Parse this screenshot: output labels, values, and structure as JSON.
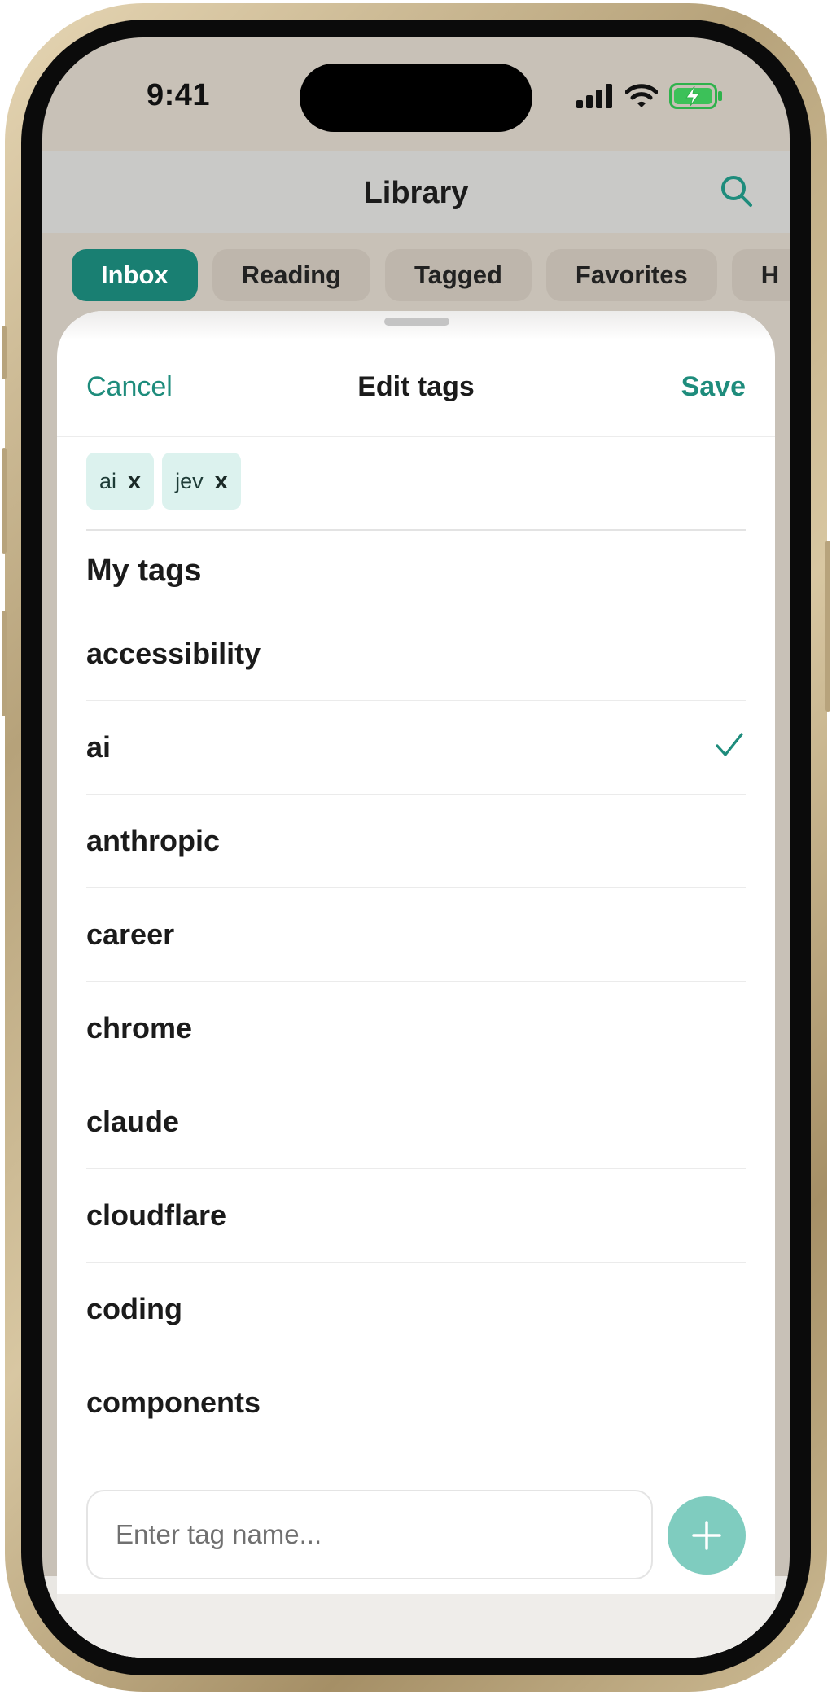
{
  "status_bar": {
    "time": "9:41"
  },
  "nav": {
    "title": "Library"
  },
  "filter_tabs": [
    {
      "label": "Inbox",
      "active": true
    },
    {
      "label": "Reading",
      "active": false
    },
    {
      "label": "Tagged",
      "active": false
    },
    {
      "label": "Favorites",
      "active": false
    },
    {
      "label": "H",
      "active": false
    }
  ],
  "sheet": {
    "cancel_label": "Cancel",
    "title": "Edit tags",
    "save_label": "Save",
    "selected_tags": [
      {
        "label": "ai",
        "remove": "x"
      },
      {
        "label": "jev",
        "remove": "x"
      }
    ],
    "section_title": "My tags",
    "tags": [
      {
        "label": "accessibility",
        "checked": false
      },
      {
        "label": "ai",
        "checked": true
      },
      {
        "label": "anthropic",
        "checked": false
      },
      {
        "label": "career",
        "checked": false
      },
      {
        "label": "chrome",
        "checked": false
      },
      {
        "label": "claude",
        "checked": false
      },
      {
        "label": "cloudflare",
        "checked": false
      },
      {
        "label": "coding",
        "checked": false
      },
      {
        "label": "components",
        "checked": false
      }
    ],
    "input_placeholder": "Enter tag name...",
    "input_value": ""
  },
  "colors": {
    "accent": "#1e8c7c",
    "active_chip": "#197f72",
    "tag_pill_bg": "#dcf2ee",
    "add_button": "#7fccbf"
  },
  "icons": {
    "search": "search-icon",
    "check": "checkmark-icon",
    "add": "plus-icon",
    "signal": "cellular-signal-icon",
    "wifi": "wifi-icon",
    "battery": "battery-charging-icon"
  }
}
